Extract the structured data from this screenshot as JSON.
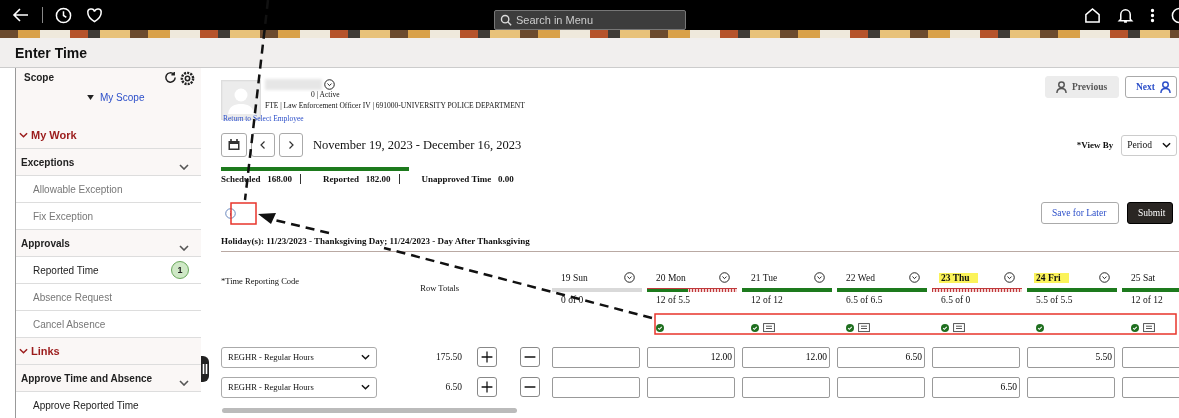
{
  "top_bar": {
    "search": {
      "placeholder": "Search in Menu"
    }
  },
  "page_title": "Enter Time",
  "sidebar": {
    "scope": {
      "title": "Scope",
      "link": "My Scope"
    },
    "sections": [
      {
        "title": "My Work",
        "groups": [
          {
            "title": "Exceptions",
            "items": [
              {
                "label": "Allowable Exception",
                "disabled": true
              },
              {
                "label": "Fix Exception",
                "disabled": true
              }
            ]
          },
          {
            "title": "Approvals",
            "items": [
              {
                "label": "Reported Time",
                "disabled": false,
                "badge": "1"
              },
              {
                "label": "Absence Request",
                "disabled": true
              },
              {
                "label": "Cancel Absence",
                "disabled": true
              }
            ]
          }
        ]
      },
      {
        "title": "Links",
        "groups": [
          {
            "title": "Approve Time and Absence",
            "items": [
              {
                "label": "Approve Reported Time",
                "disabled": false
              }
            ]
          }
        ]
      }
    ]
  },
  "employee": {
    "status": "0 | Active",
    "details": "FTE | Law Enforcement Officer IV | 691000-UNIVERSITY POLICE DEPARTMENT",
    "return_link": "Return to Select Employee"
  },
  "nav_buttons": [
    {
      "label": "Previous",
      "disabled": true
    },
    {
      "label": "Next",
      "disabled": false
    }
  ],
  "period": {
    "range": "November 19, 2023 - December 16, 2023",
    "level": 1
  },
  "view_by": {
    "label": "*View By",
    "value": "Period"
  },
  "summary": [
    {
      "label": "Scheduled",
      "value": "168.00"
    },
    {
      "label": "Reported",
      "value": "182.00"
    },
    {
      "label": "Unapproved Time",
      "value": "0.00"
    }
  ],
  "actions": [
    {
      "label": "Save for Later",
      "kind": "secondary"
    },
    {
      "label": "Submit",
      "kind": "primary"
    }
  ],
  "holidays": "Holiday(s): 11/23/2023 - Thanksgiving Day; 11/24/2023 - Day After Thanksgiving",
  "table": {
    "code_header": "*Time Reporting Code",
    "totals_header": "Row Totals",
    "days": [
      {
        "label": "19 Sun",
        "holiday": false,
        "level": 0,
        "over": false,
        "count": "0 of 0",
        "approved": false,
        "comment": false
      },
      {
        "label": "20 Mon",
        "holiday": false,
        "level": 0.45,
        "over": true,
        "count": "12 of 5.5",
        "approved": true,
        "comment": false
      },
      {
        "label": "21 Tue",
        "holiday": false,
        "level": 1,
        "over": false,
        "count": "12 of 12",
        "approved": true,
        "comment": true
      },
      {
        "label": "22 Wed",
        "holiday": false,
        "level": 1,
        "over": false,
        "count": "6.5 of 6.5",
        "approved": true,
        "comment": true
      },
      {
        "label": "23 Thu",
        "holiday": true,
        "level": 0,
        "over": true,
        "count": "6.5 of 0",
        "approved": true,
        "comment": true
      },
      {
        "label": "24 Fri",
        "holiday": true,
        "level": 1,
        "over": false,
        "count": "5.5 of 5.5",
        "approved": true,
        "comment": false
      },
      {
        "label": "25 Sat",
        "holiday": false,
        "level": 1,
        "over": false,
        "count": "12 of 12",
        "approved": true,
        "comment": true
      }
    ],
    "rows": [
      {
        "code": "REGHR - Regular Hours",
        "total": "175.50",
        "cells": [
          {},
          {
            "value": "12.00"
          },
          {
            "value": "12.00"
          },
          {
            "value": "6.50"
          },
          {},
          {
            "value": "5.50"
          },
          {}
        ]
      },
      {
        "code": "REGHR - Regular Hours",
        "total": "6.50",
        "cells": [
          {},
          {},
          {},
          {},
          {
            "value": "6.50"
          },
          {},
          {}
        ]
      }
    ]
  }
}
